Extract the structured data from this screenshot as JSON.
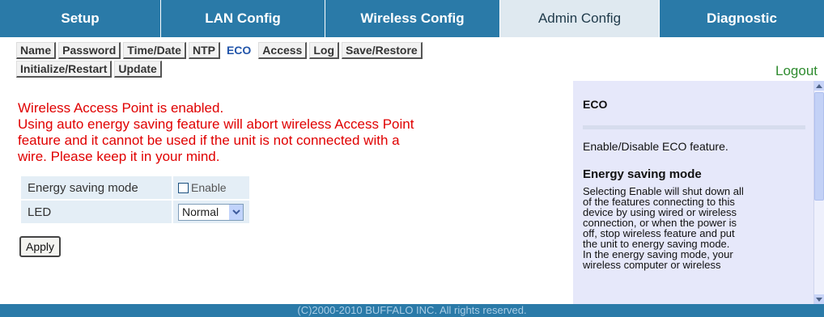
{
  "top_tabs": [
    {
      "label": "Setup"
    },
    {
      "label": "LAN Config"
    },
    {
      "label": "Wireless Config"
    },
    {
      "label": "Admin Config"
    },
    {
      "label": "Diagnostic"
    }
  ],
  "sub_nav": {
    "row1": [
      "Name",
      "Password",
      "Time/Date",
      "NTP",
      "ECO",
      "Access",
      "Log",
      "Save/Restore"
    ],
    "row2": [
      "Initialize/Restart",
      "Update"
    ],
    "active": "ECO"
  },
  "logout_label": "Logout",
  "warning": {
    "line1": "Wireless Access Point is enabled.",
    "line2": "Using auto energy saving feature will abort wireless Access Point",
    "line3": "feature and it cannot be used if the unit is not connected with a",
    "line4": "wire. Please keep it in your mind."
  },
  "settings": {
    "energy_saving_label": "Energy saving mode",
    "enable_label": "Enable",
    "enable_checked": false,
    "led_label": "LED",
    "led_value": "Normal"
  },
  "apply_label": "Apply",
  "help": {
    "title": "ECO",
    "summary": "Enable/Disable ECO feature.",
    "subtitle": "Energy saving mode",
    "lines": [
      "Selecting Enable will shut down all",
      "of the features connecting to this",
      "device by using wired or wireless",
      "connection, or when the power is",
      "off, stop wireless feature and put",
      "the unit to energy saving mode.",
      "In the energy saving mode, your",
      "wireless computer or wireless"
    ]
  },
  "footer": "(C)2000-2010 BUFFALO INC. All rights reserved.",
  "colors": {
    "tab_bar": "#2a7aa8",
    "active_tab": "#dfe9f0",
    "warning_text": "#e00000",
    "logout_text": "#2e8b2e",
    "help_panel": "#e6e8fa"
  }
}
